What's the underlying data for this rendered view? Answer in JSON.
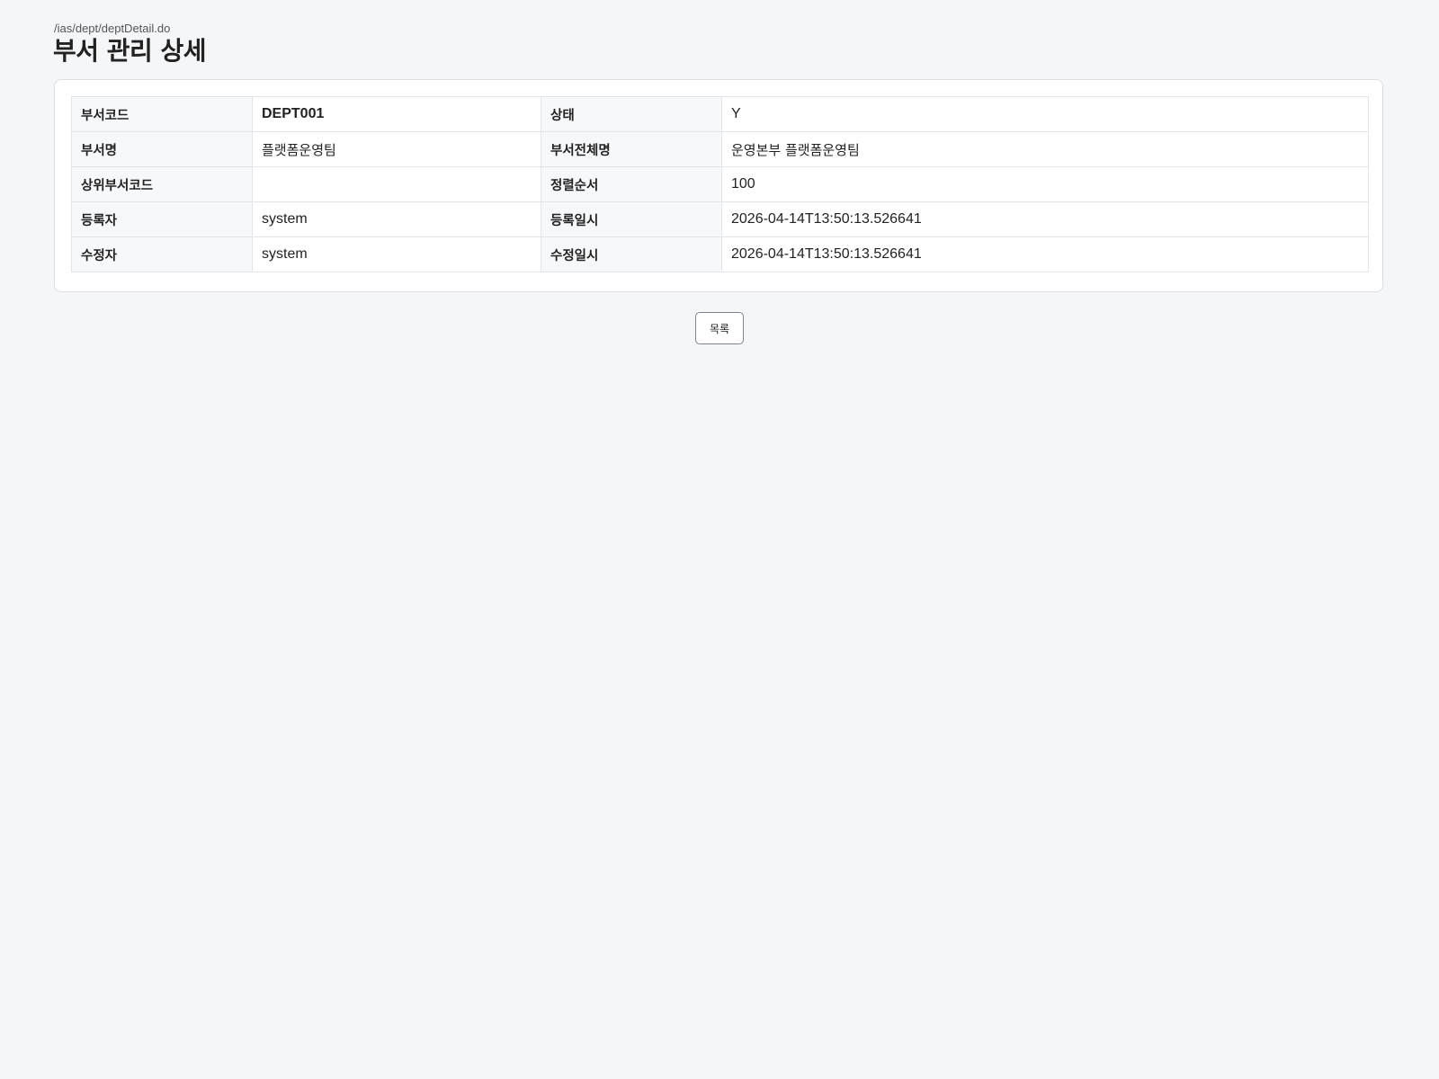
{
  "header": {
    "path": "/ias/dept/deptDetail.do",
    "title": "부서 관리 상세"
  },
  "detail": {
    "rows": [
      {
        "label1": "부서코드",
        "value1": "DEPT001",
        "label2": "상태",
        "value2": "Y"
      },
      {
        "label1": "부서명",
        "value1": "플랫폼운영팀",
        "label2": "부서전체명",
        "value2": "운영본부 플랫폼운영팀"
      },
      {
        "label1": "상위부서코드",
        "value1": "",
        "label2": "정렬순서",
        "value2": "100"
      },
      {
        "label1": "등록자",
        "value1": "system",
        "label2": "등록일시",
        "value2": "2026-04-14T13:50:13.526641"
      },
      {
        "label1": "수정자",
        "value1": "system",
        "label2": "수정일시",
        "value2": "2026-04-14T13:50:13.526641"
      }
    ]
  },
  "actions": {
    "list_label": "목록"
  },
  "colors": {
    "page_background": "#f4f6f8",
    "card_background": "#ffffff",
    "label_background": "#f7f8fa",
    "border": "#e1e4e8"
  }
}
